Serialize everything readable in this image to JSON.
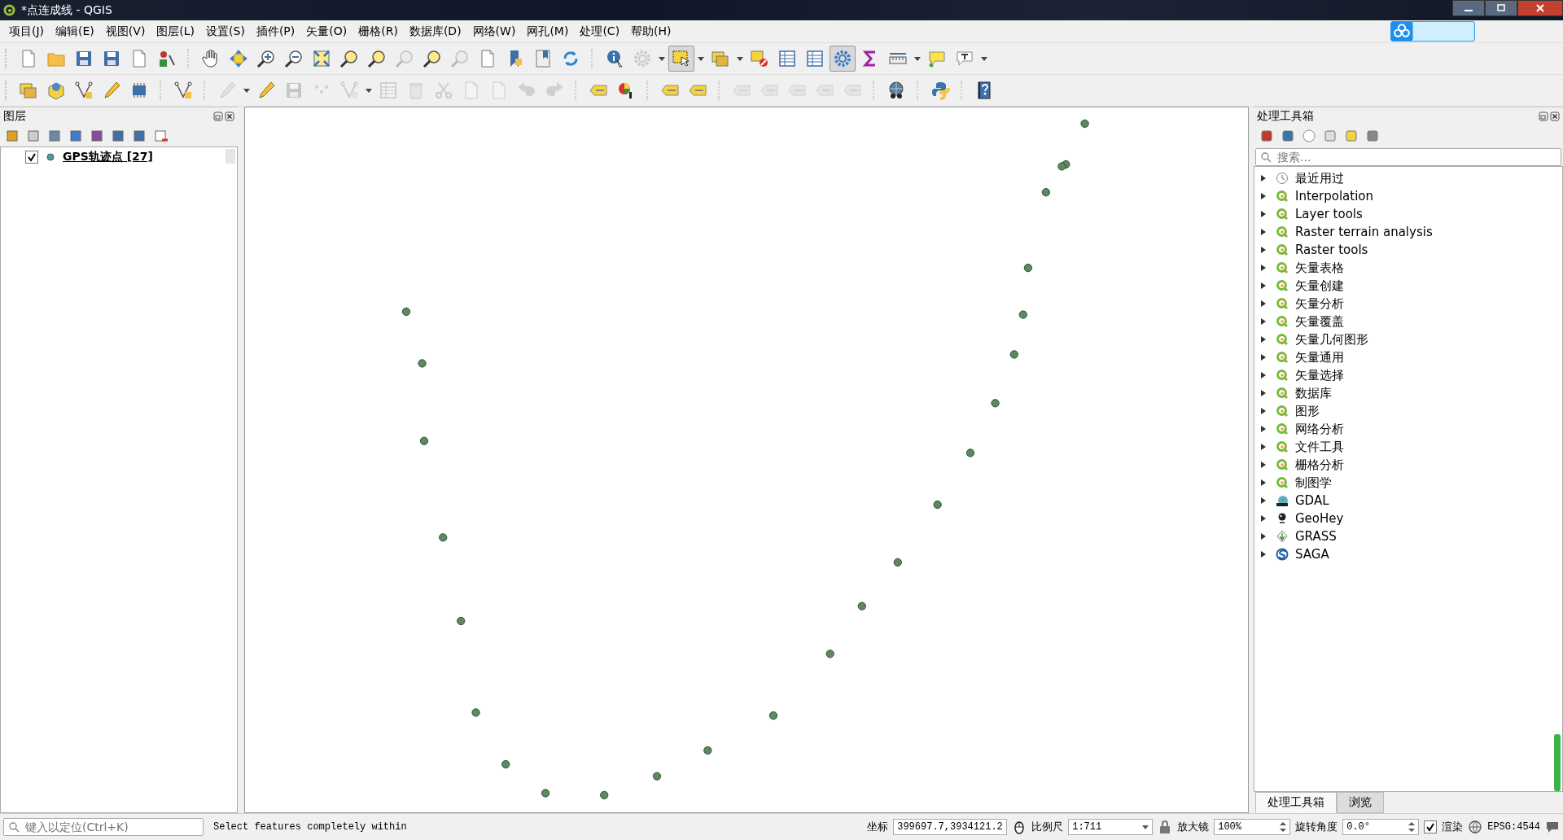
{
  "window": {
    "title": "*点连成线 - QGIS"
  },
  "menu": [
    "项目(J)",
    "编辑(E)",
    "视图(V)",
    "图层(L)",
    "设置(S)",
    "插件(P)",
    "矢量(O)",
    "栅格(R)",
    "数据库(D)",
    "网络(W)",
    "网孔(M)",
    "处理(C)",
    "帮助(H)"
  ],
  "layers_panel": {
    "title": "图层",
    "layers": [
      {
        "name": "GPS轨迹点 [27]",
        "checked": true
      }
    ]
  },
  "toolbox_panel": {
    "title": "处理工具箱",
    "search": {
      "placeholder": "搜索..."
    },
    "groups": [
      {
        "label": "最近用过",
        "kind": "recent",
        "expanded": false
      },
      {
        "label": "Interpolation",
        "kind": "qgis",
        "expanded": false
      },
      {
        "label": "Layer tools",
        "kind": "qgis",
        "expanded": false
      },
      {
        "label": "Raster terrain analysis",
        "kind": "qgis",
        "expanded": false
      },
      {
        "label": "Raster tools",
        "kind": "qgis",
        "expanded": false
      },
      {
        "label": "矢量表格",
        "kind": "qgis",
        "expanded": false
      },
      {
        "label": "矢量创建",
        "kind": "qgis",
        "expanded": false
      },
      {
        "label": "矢量分析",
        "kind": "qgis",
        "expanded": false
      },
      {
        "label": "矢量覆盖",
        "kind": "qgis",
        "expanded": false
      },
      {
        "label": "矢量几何图形",
        "kind": "qgis",
        "expanded": false
      },
      {
        "label": "矢量通用",
        "kind": "qgis",
        "expanded": false
      },
      {
        "label": "矢量选择",
        "kind": "qgis",
        "expanded": false
      },
      {
        "label": "数据库",
        "kind": "qgis",
        "expanded": false
      },
      {
        "label": "图形",
        "kind": "qgis",
        "expanded": false
      },
      {
        "label": "网络分析",
        "kind": "qgis",
        "expanded": false
      },
      {
        "label": "文件工具",
        "kind": "qgis",
        "expanded": false
      },
      {
        "label": "栅格分析",
        "kind": "qgis",
        "expanded": false
      },
      {
        "label": "制图学",
        "kind": "qgis",
        "expanded": false
      },
      {
        "label": "GDAL",
        "kind": "gdal",
        "expanded": false
      },
      {
        "label": "GeoHey",
        "kind": "geohey",
        "expanded": false
      },
      {
        "label": "GRASS",
        "kind": "grass",
        "expanded": false
      },
      {
        "label": "SAGA",
        "kind": "saga",
        "expanded": false
      }
    ]
  },
  "panel_tabs": [
    {
      "label": "处理工具箱",
      "selected": true
    },
    {
      "label": "浏览",
      "selected": false
    }
  ],
  "status_bar": {
    "locator": {
      "placeholder": "键入以定位(Ctrl+K)"
    },
    "message": "Select features completely within",
    "coordinate_label": "坐标",
    "coordinate": "399697.7,3934121.2",
    "scale_label": "比例尺",
    "scale": "1:711",
    "magnifier_label": "放大镜",
    "magnifier": "100%",
    "rotation_label": "旋转角度",
    "rotation": "0.0°",
    "render": {
      "label": "渲染",
      "checked": true
    },
    "crs": "EPSG:4544"
  }
}
